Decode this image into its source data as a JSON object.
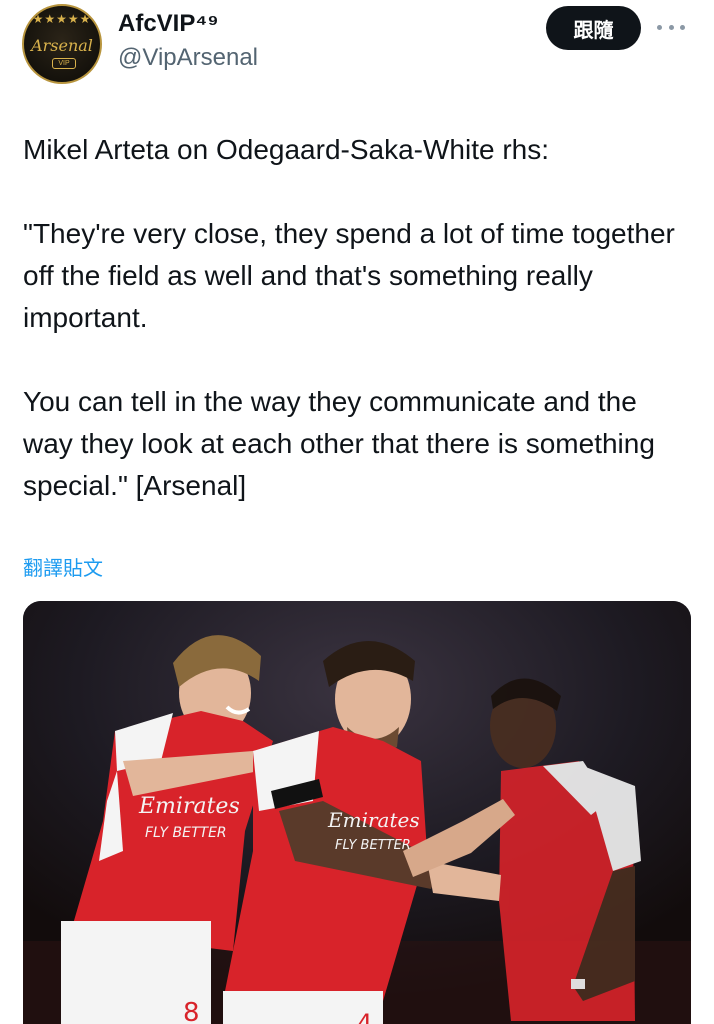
{
  "header": {
    "avatar": {
      "brand": "Arsenal",
      "badge": "VIP",
      "stars": "★★★★★"
    },
    "display_name": "AfcVIP⁴⁹",
    "handle": "@VipArsenal",
    "follow_label": "跟隨",
    "more_icon": "more-horizontal-icon"
  },
  "tweet": {
    "text": "Mikel Arteta on Odegaard-Saka-White rhs:\n\n\"They're very close, they spend a lot of time together off the field as well and that's something really important.\n\nYou can tell in the way they communicate and the way they look at each other that there is something special.\" [Arsenal]",
    "translate_label": "翻譯貼文"
  },
  "media": {
    "shirt_sponsor_1": "Emirates",
    "shirt_tagline_1": "FLY BETTER",
    "shirt_sponsor_2": "Emirates",
    "shirt_tagline_2": "FLY BETTER",
    "shirt_number_1": "8",
    "shirt_number_2": "4",
    "colors": {
      "shirt_red": "#d8232a",
      "sleeve_white": "#f4f4f4",
      "skin_light": "#e2b69a",
      "skin_dark": "#5a3a28"
    }
  }
}
